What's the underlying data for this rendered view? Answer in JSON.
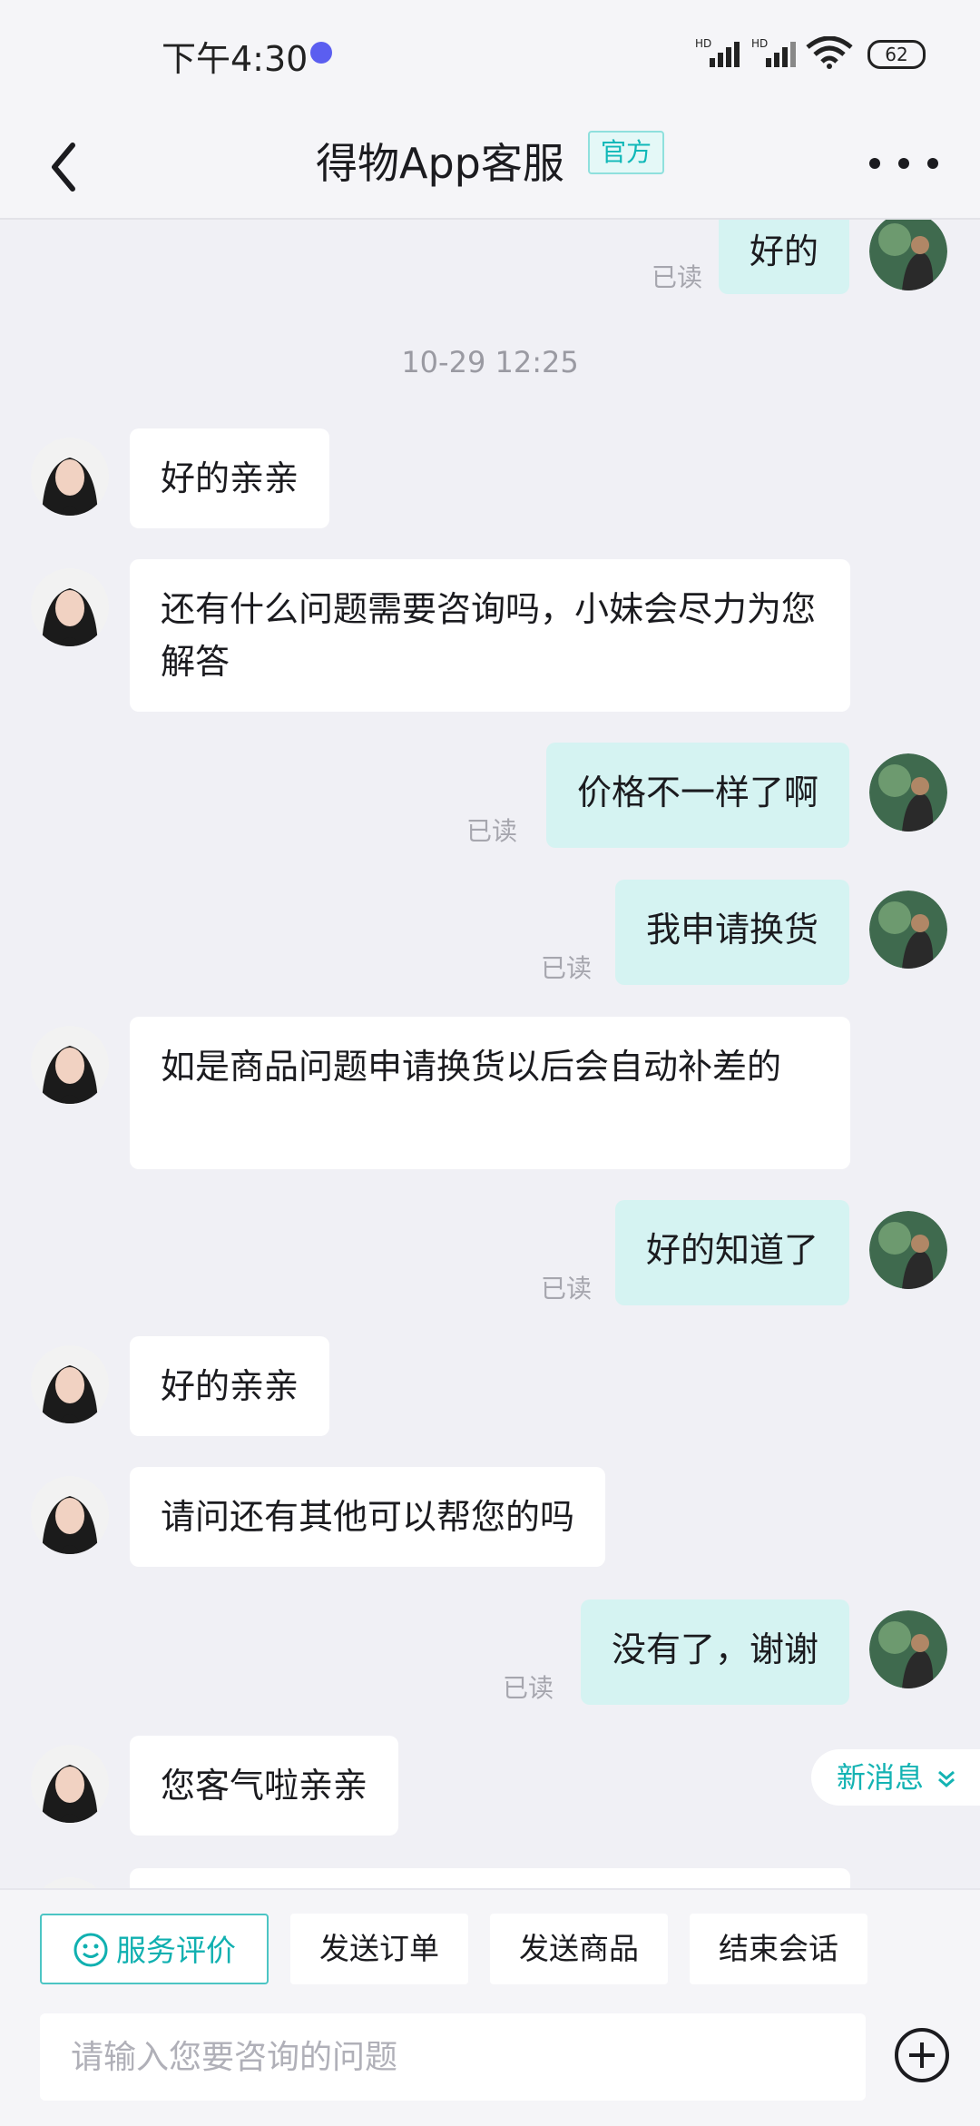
{
  "status_bar": {
    "time": "下午4:30",
    "battery": "62",
    "signal_label": "HD"
  },
  "header": {
    "title": "得物App客服",
    "badge": "官方"
  },
  "read_label": "已读",
  "timestamp": "10-29 12:25",
  "messages": {
    "m0": {
      "from": "user",
      "text": "好的"
    },
    "m1": {
      "from": "agent",
      "text": "好的亲亲"
    },
    "m2": {
      "from": "agent",
      "text": "还有什么问题需要咨询吗，小妹会尽力为您解答"
    },
    "m3": {
      "from": "user",
      "text": "价格不一样了啊"
    },
    "m4": {
      "from": "user",
      "text": "我申请换货"
    },
    "m5": {
      "from": "agent",
      "text": "如是商品问题申请换货以后会自动补差的"
    },
    "m6": {
      "from": "user",
      "text": "好的知道了"
    },
    "m7": {
      "from": "agent",
      "text": "好的亲亲"
    },
    "m8": {
      "from": "agent",
      "text": "请问还有其他可以帮您的吗"
    },
    "m9": {
      "from": "user",
      "text": "没有了，谢谢"
    },
    "m10": {
      "from": "agent",
      "text": "您客气啦亲亲"
    }
  },
  "new_message_label": "新消息",
  "quick_actions": {
    "rate": "服务评价",
    "send_order": "发送订单",
    "send_product": "发送商品",
    "end_session": "结束会话"
  },
  "input": {
    "placeholder": "请输入您要咨询的问题"
  },
  "colors": {
    "accent": "#10b0b0",
    "user_bubble": "#d5f3f2",
    "agent_bubble": "#ffffff",
    "background": "#f0f0f5"
  },
  "icons": [
    "back-icon",
    "more-icon",
    "smile-icon",
    "plus-icon",
    "chevron-down-icon",
    "wifi-icon",
    "signal-icon",
    "battery-icon"
  ]
}
